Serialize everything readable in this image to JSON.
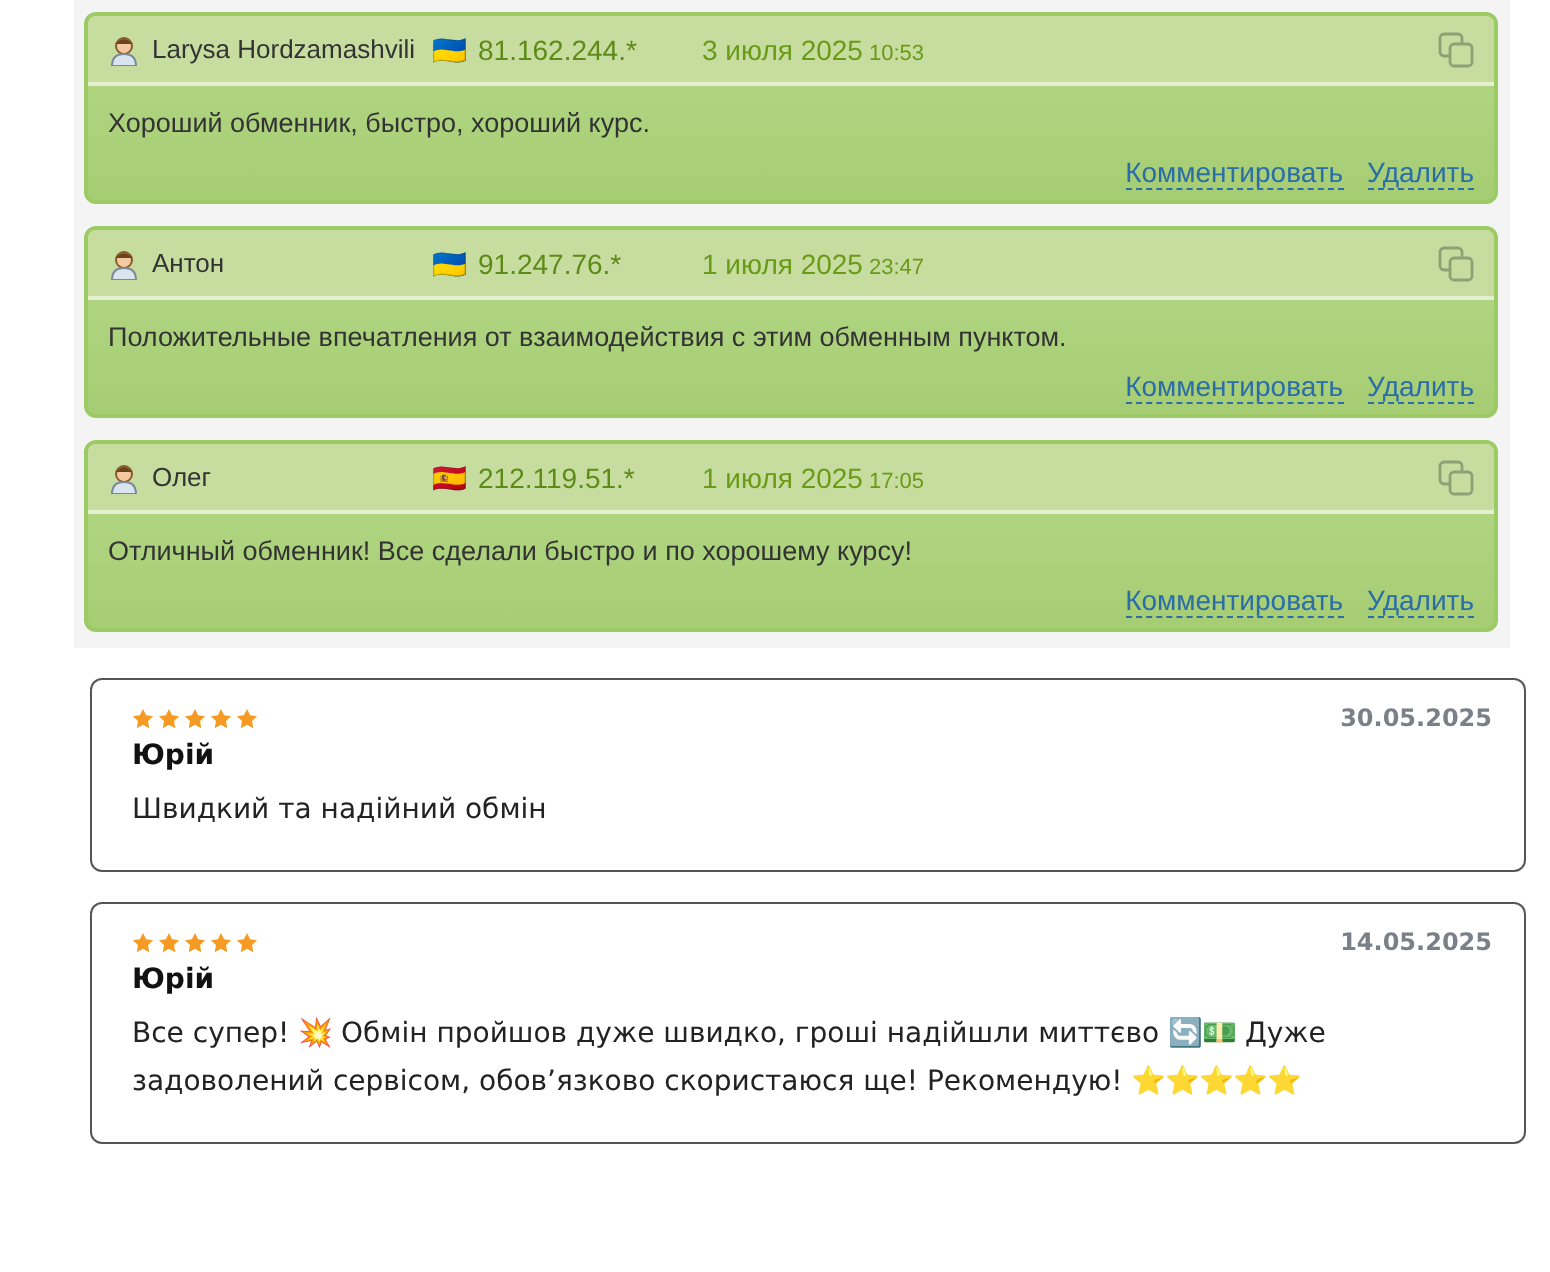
{
  "comments": [
    {
      "author": "Larysa Hordzamashvili",
      "flag": "🇺🇦",
      "ip": "81.162.244.*",
      "date": "3 июля 2025",
      "time": "10:53",
      "text": "Хороший обменник, быстро, хороший курс.",
      "actions": [
        "Комментировать",
        "Удалить"
      ]
    },
    {
      "author": "Антон",
      "flag": "🇺🇦",
      "ip": "91.247.76.*",
      "date": "1 июля 2025",
      "time": "23:47",
      "text": "Положительные впечатления от взаимодействия с этим обменным пунктом.",
      "actions": [
        "Комментировать",
        "Удалить"
      ]
    },
    {
      "author": "Олег",
      "flag": "🇪🇸",
      "ip": "212.119.51.*",
      "date": "1 июля 2025",
      "time": "17:05",
      "text": "Отличный обменник! Все сделали быстро и по хорошему курсу!",
      "actions": [
        "Комментировать",
        "Удалить"
      ]
    }
  ],
  "reviews": [
    {
      "stars": 5,
      "date": "30.05.2025",
      "author": "Юрій",
      "text": "Швидкий та надійний обмін"
    },
    {
      "stars": 5,
      "date": "14.05.2025",
      "author": "Юрій",
      "text": "Все супер! 💥 Обмін пройшов дуже швидко, гроші надійшли миттєво 🔄💵 Дуже задоволений сервісом, обов’язково скористаюся ще! Рекомендую! ⭐⭐⭐⭐⭐"
    }
  ]
}
